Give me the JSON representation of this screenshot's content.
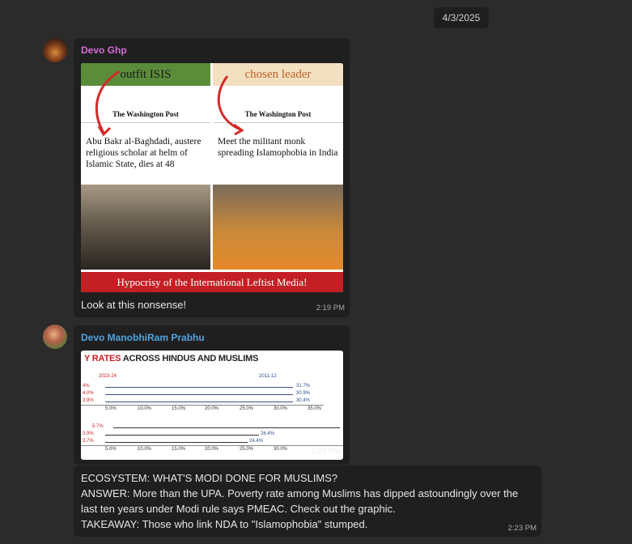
{
  "date_chip": "4/3/2025",
  "messages": [
    {
      "sender": "Devo Ghp",
      "text": "Look at this nonsense!",
      "time": "2:19 PM",
      "image": {
        "left": {
          "band": "outfit ISIS",
          "masthead": "The Washington Post",
          "headline": "Abu Bakr al-Baghdadi, austere religious scholar at helm of Islamic State, dies at 48"
        },
        "right": {
          "band": "chosen leader",
          "masthead": "The Washington Post",
          "headline": "Meet the militant monk spreading Islamophobia in India"
        },
        "caption": "Hypocrisy of the International Leftist Media!"
      }
    },
    {
      "sender": "Devo ManobhiRam Prabhu",
      "time": "2:23 PM",
      "image": {
        "title_prefix": "Y RATES",
        "title_rest": " ACROSS HINDUS AND MUSLIMS",
        "top": {
          "left_label": "2023-24",
          "right_label": "2011-12",
          "left_values": [
            "4%",
            "4.0%",
            "3.9%"
          ],
          "right_values": [
            "31.7%",
            "30.9%",
            "30.4%"
          ]
        },
        "bottom": {
          "left_values": [
            "5.7%",
            "3.9%",
            "3.7%"
          ],
          "right_values": [
            "26.4%",
            "24.4%"
          ]
        },
        "ticks": [
          "5.0%",
          "10.0%",
          "15.0%",
          "20.0%",
          "25.0%",
          "30.0%",
          "35.0%"
        ]
      }
    },
    {
      "lines": [
        "ECOSYSTEM: WHAT'S MODI DONE FOR MUSLIMS?",
        "ANSWER: More than the UPA. Poverty rate among Muslims has dipped astoundingly over the last ten years under Modi rule says PMEAC. Check out the graphic.",
        "TAKEAWAY: Those who link NDA to \"Islamophobia\" stumped."
      ],
      "time": "2:23 PM"
    }
  ]
}
